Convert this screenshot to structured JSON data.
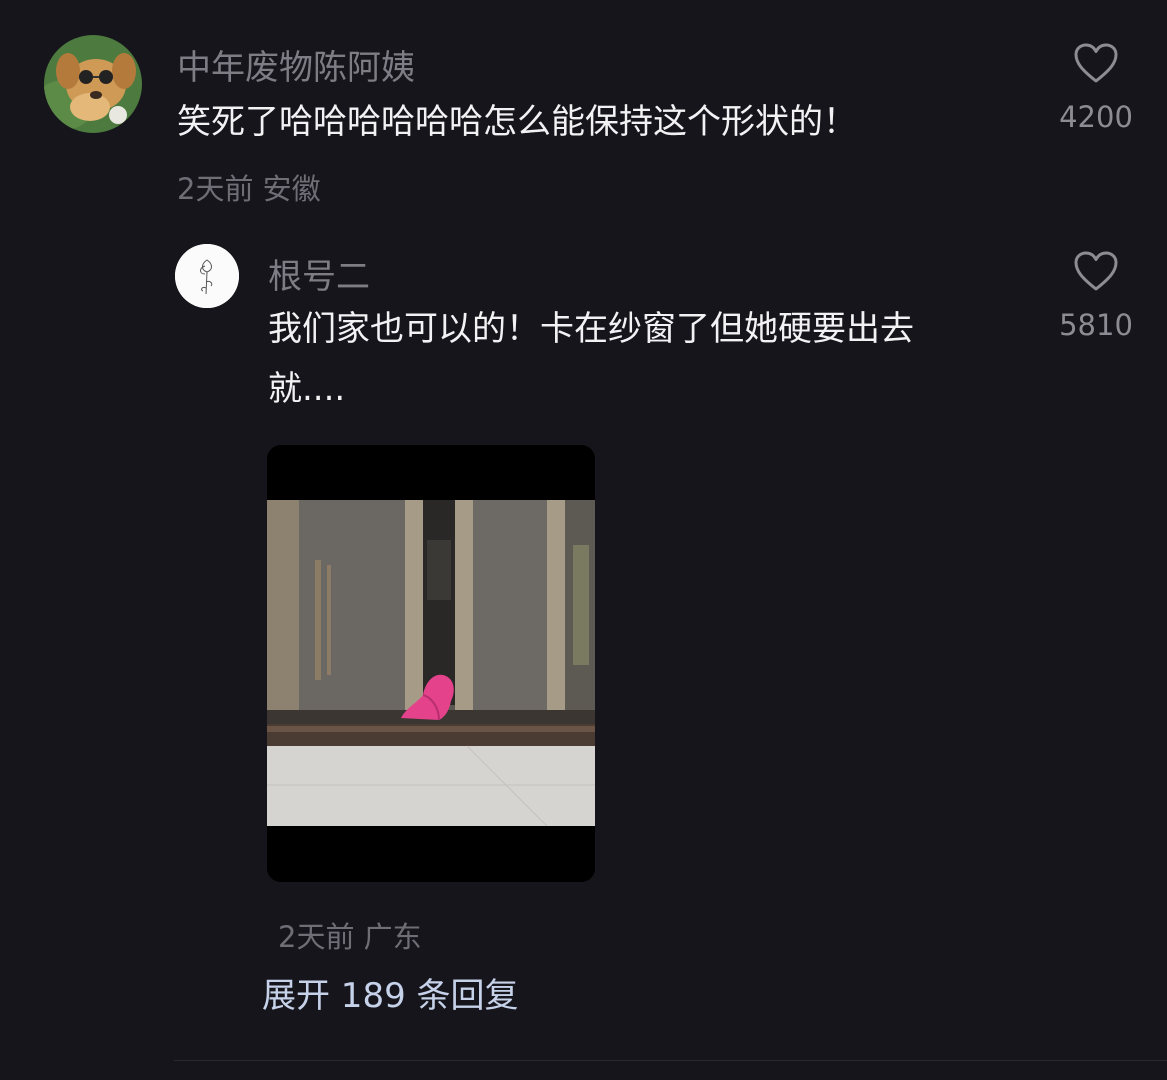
{
  "comments": [
    {
      "username": "中年废物陈阿姨",
      "text": "笑死了哈哈哈哈哈哈怎么能保持这个形状的！",
      "time": "2天前",
      "location": "安徽",
      "likes": "4200",
      "avatar_icon": "golden-retriever-photo"
    }
  ],
  "reply": {
    "username": "根号二",
    "text_line1": "我们家也可以的！卡在纱窗了但她硬要出去",
    "text_line2": "就....",
    "time": "2天前",
    "location": "广东",
    "likes": "5810",
    "avatar_icon": "line-drawing-flower",
    "image_icon": "photo-sliding-screen-door-pink-cloth"
  },
  "expand_replies": "展开 189 条回复",
  "colors": {
    "background": "#16151b",
    "username": "#7e7c84",
    "text": "#f2f2f4",
    "meta": "#6f6d76",
    "link": "#c6d2ea"
  }
}
